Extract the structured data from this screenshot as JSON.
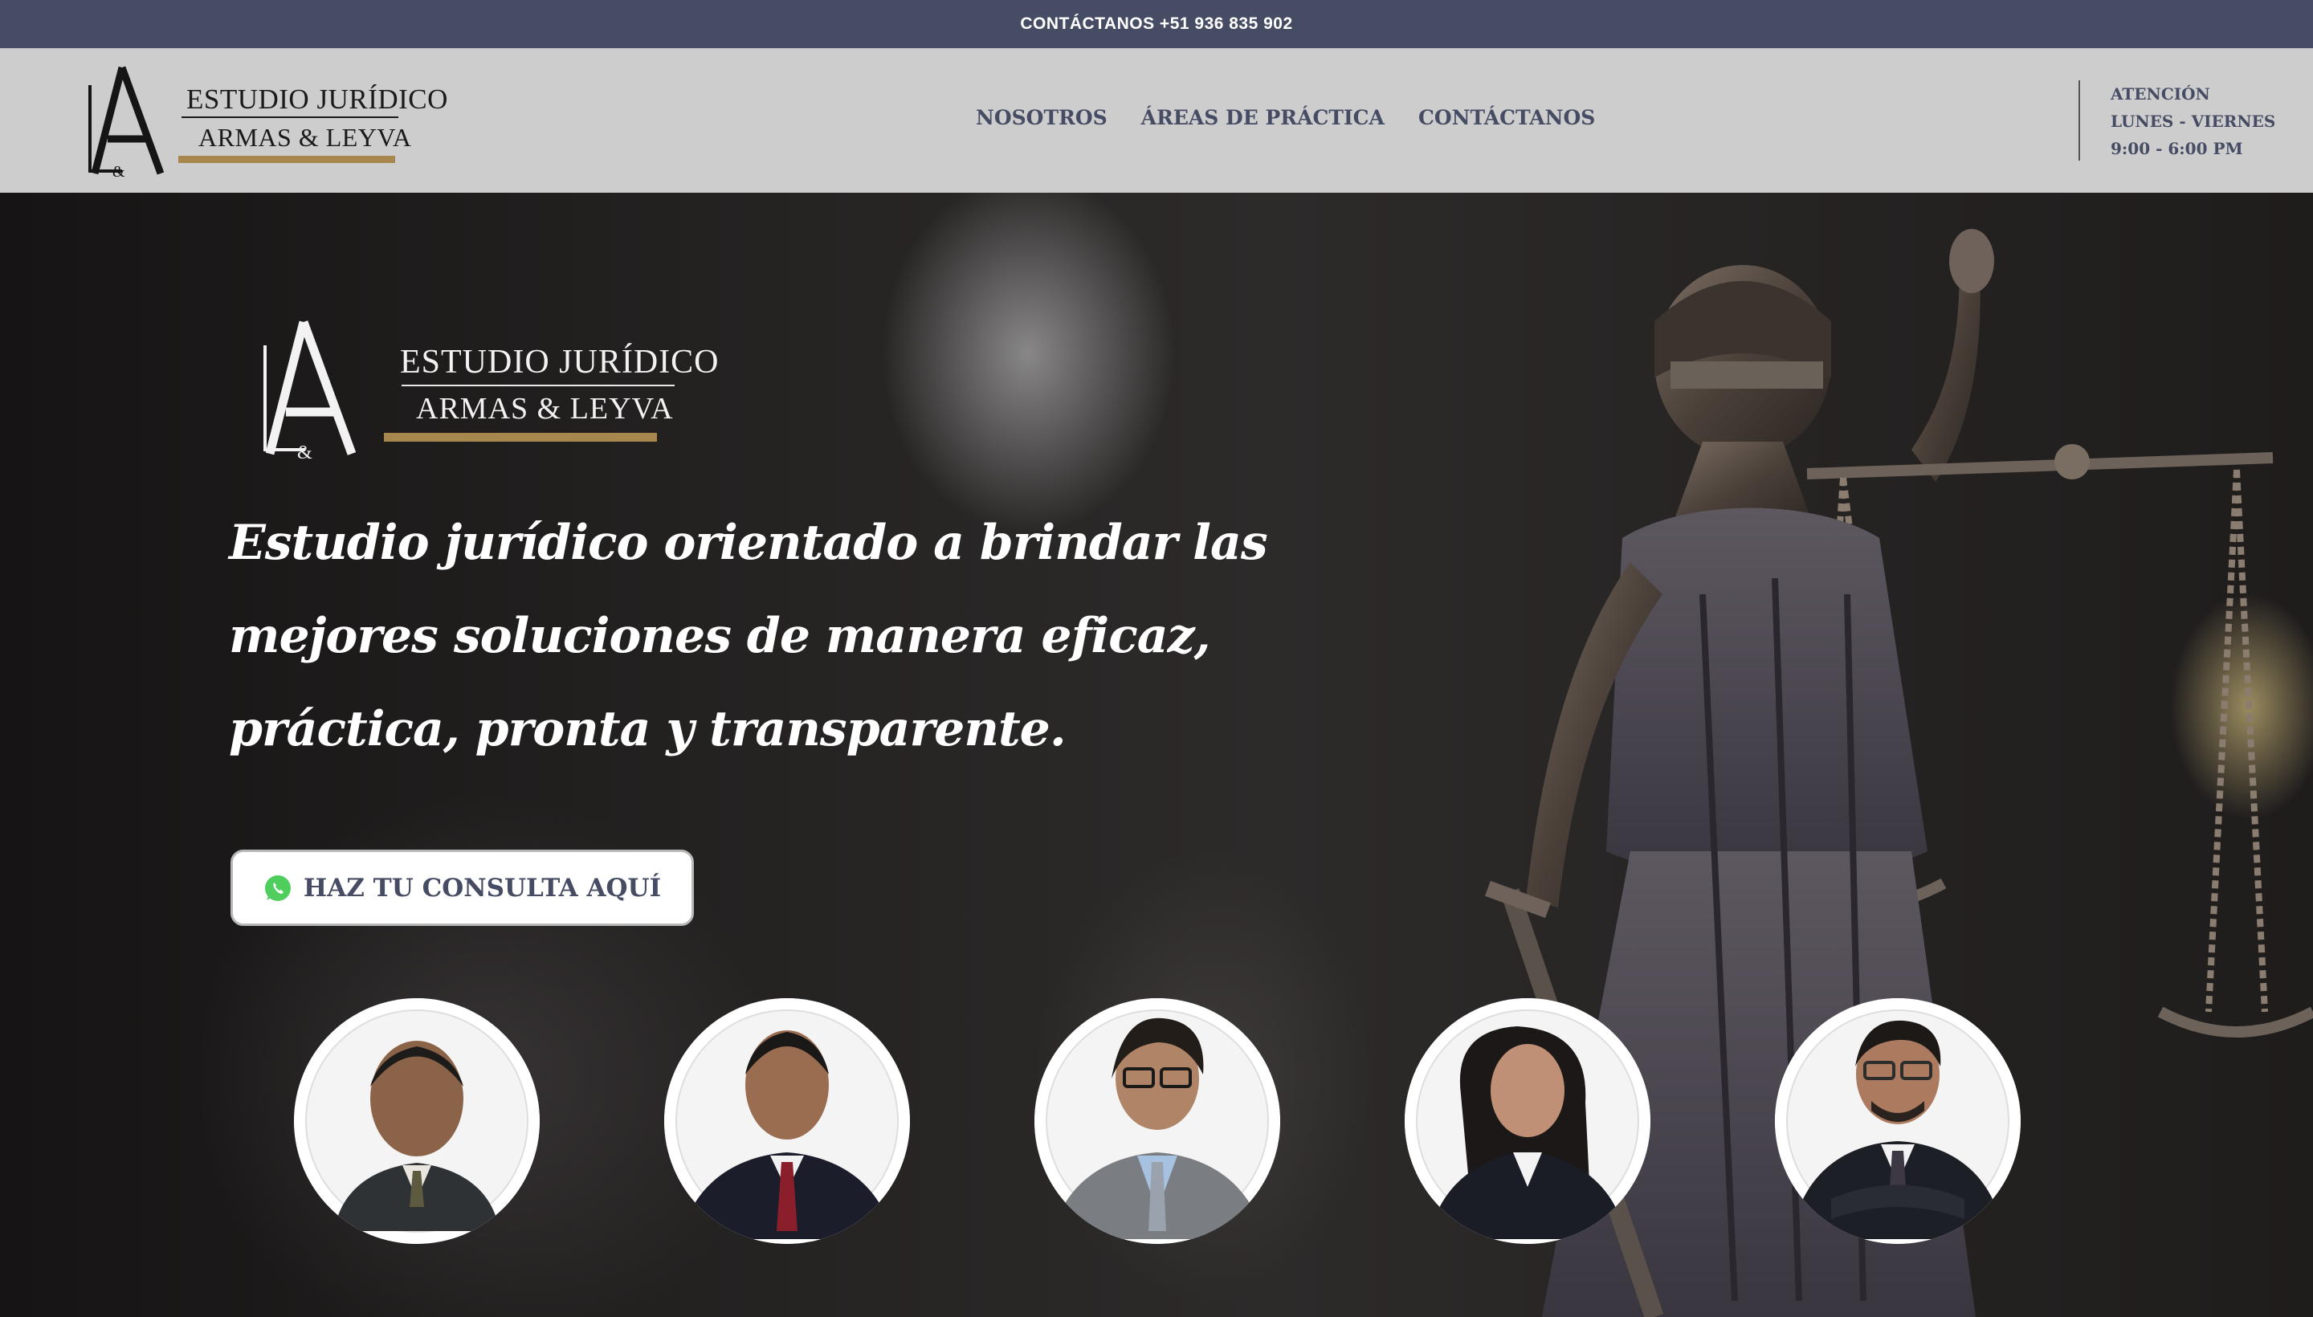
{
  "topbar": {
    "contact_text": "CONTÁCTANOS +51 936 835 902"
  },
  "header": {
    "logo": {
      "monogram_text": "LA&",
      "line1": "ESTUDIO JURÍDICO",
      "line2": "ARMAS & LEYVA"
    },
    "nav": [
      {
        "label": "NOSOTROS"
      },
      {
        "label": "ÁREAS DE PRÁCTICA"
      },
      {
        "label": "CONTÁCTANOS"
      }
    ],
    "hours": {
      "title": "ATENCIÓN",
      "days": "LUNES - VIERNES",
      "time": "9:00 - 6:00 PM"
    }
  },
  "hero": {
    "logo": {
      "line1": "ESTUDIO JURÍDICO",
      "line2": "ARMAS & LEYVA"
    },
    "tagline": "Estudio jurídico orientado a brindar las mejores soluciones de manera eficaz, práctica, pronta y transparente.",
    "cta": {
      "label": "HAZ TU CONSULTA AQUÍ",
      "icon": "whatsapp-icon"
    },
    "team": [
      {
        "photo": "lawyer-photo-1"
      },
      {
        "photo": "lawyer-photo-2"
      },
      {
        "photo": "lawyer-photo-3"
      },
      {
        "photo": "lawyer-photo-4"
      },
      {
        "photo": "lawyer-photo-5"
      }
    ]
  },
  "colors": {
    "topbar_bg": "#454c63",
    "header_bg": "#cdcdcd",
    "nav_text": "#454c63",
    "gold_accent": "#a7874d",
    "whatsapp_green": "#4fce5d"
  }
}
